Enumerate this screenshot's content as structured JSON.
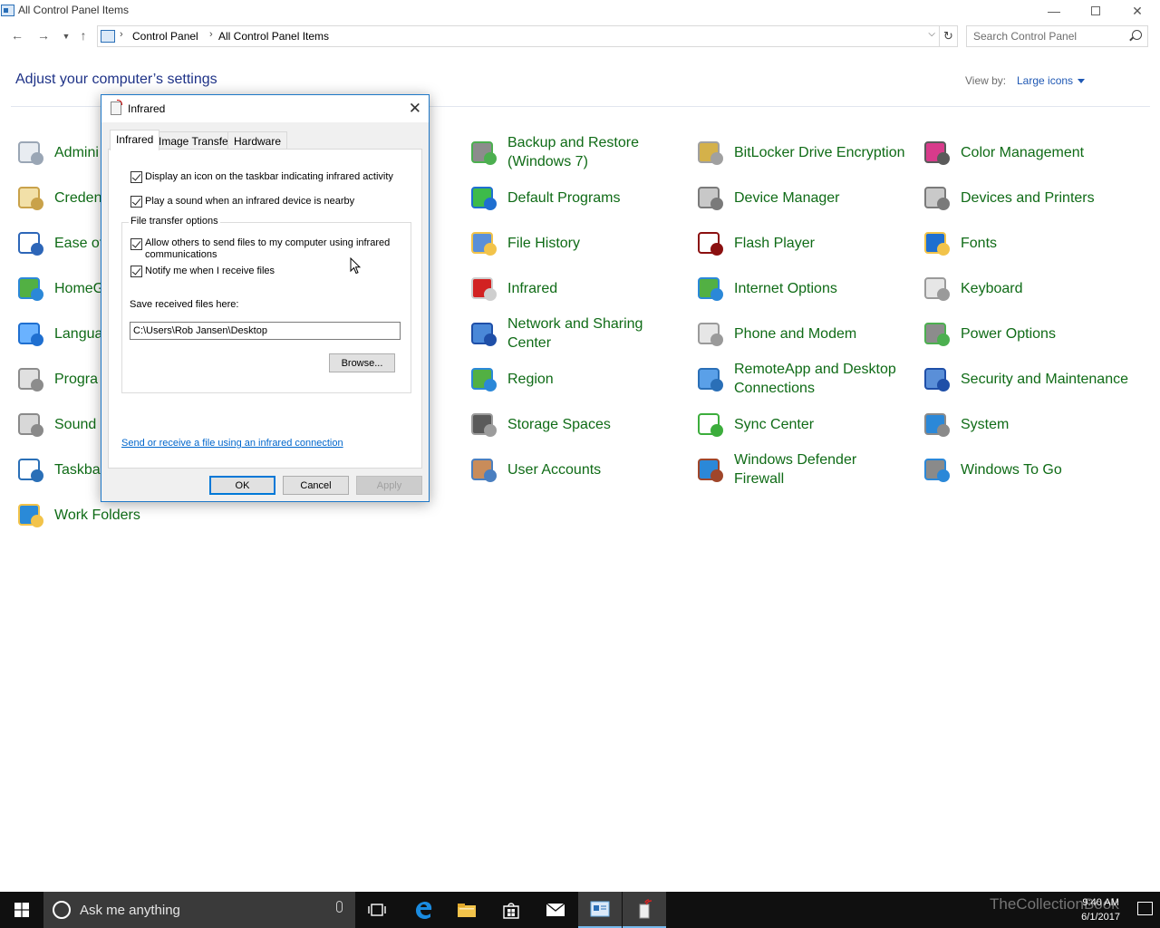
{
  "window": {
    "title": "All Control Panel Items"
  },
  "address": {
    "crumbs": [
      "Control Panel",
      "All Control Panel Items"
    ],
    "search_placeholder": "Search Control Panel"
  },
  "page": {
    "title": "Adjust your computer’s settings",
    "view_by_label": "View by:",
    "view_by_value": "Large icons"
  },
  "items": [
    {
      "label": "Admini",
      "icon": "administrative-tools-icon"
    },
    {
      "label": "Creden",
      "icon": "credential-manager-icon"
    },
    {
      "label": "Ease of",
      "icon": "ease-of-access-icon"
    },
    {
      "label": "HomeG",
      "icon": "homegroup-icon"
    },
    {
      "label": "Langua",
      "icon": "language-icon"
    },
    {
      "label": "Progra",
      "icon": "programs-icon"
    },
    {
      "label": "Sound",
      "icon": "sound-icon"
    },
    {
      "label": "Taskbar",
      "icon": "taskbar-icon"
    },
    {
      "label": "Work Folders",
      "icon": "work-folders-icon"
    },
    {
      "label": "Backup and Restore (Windows 7)",
      "icon": "backup-restore-icon"
    },
    {
      "label": "Default Programs",
      "icon": "default-programs-icon"
    },
    {
      "label": "File History",
      "icon": "file-history-icon"
    },
    {
      "label": "Infrared",
      "icon": "infrared-icon"
    },
    {
      "label": "Network and Sharing Center",
      "icon": "network-sharing-icon"
    },
    {
      "label": "Region",
      "icon": "region-icon"
    },
    {
      "label": "Storage Spaces",
      "icon": "storage-spaces-icon"
    },
    {
      "label": "User Accounts",
      "icon": "user-accounts-icon"
    },
    {
      "label": "BitLocker Drive Encryption",
      "icon": "bitlocker-icon"
    },
    {
      "label": "Device Manager",
      "icon": "device-manager-icon"
    },
    {
      "label": "Flash Player",
      "icon": "flash-player-icon"
    },
    {
      "label": "Internet Options",
      "icon": "internet-options-icon"
    },
    {
      "label": "Phone and Modem",
      "icon": "phone-modem-icon"
    },
    {
      "label": "RemoteApp and Desktop Connections",
      "icon": "remoteapp-icon"
    },
    {
      "label": "Sync Center",
      "icon": "sync-center-icon"
    },
    {
      "label": "Windows Defender Firewall",
      "icon": "firewall-icon"
    },
    {
      "label": "Color Management",
      "icon": "color-management-icon"
    },
    {
      "label": "Devices and Printers",
      "icon": "devices-printers-icon"
    },
    {
      "label": "Fonts",
      "icon": "fonts-icon"
    },
    {
      "label": "Keyboard",
      "icon": "keyboard-icon"
    },
    {
      "label": "Power Options",
      "icon": "power-options-icon"
    },
    {
      "label": "Security and Maintenance",
      "icon": "security-maintenance-icon"
    },
    {
      "label": "System",
      "icon": "system-icon"
    },
    {
      "label": "Windows To Go",
      "icon": "windows-to-go-icon"
    }
  ],
  "dialog": {
    "title": "Infrared",
    "tabs": [
      "Infrared",
      "Image Transfer",
      "Hardware"
    ],
    "active_tab": "Infrared",
    "options": [
      {
        "label": "Display an icon on the taskbar indicating infrared activity",
        "checked": true
      },
      {
        "label": "Play a sound when an infrared device is nearby",
        "checked": true
      }
    ],
    "group_title": "File transfer options",
    "group_options": [
      {
        "label": "Allow others to send files to my computer using infrared communications",
        "checked": true
      },
      {
        "label": "Notify me when I receive files",
        "checked": true
      }
    ],
    "save_label": "Save received files here:",
    "save_path": "C:\\Users\\Rob Jansen\\Desktop",
    "browse_label": "Browse...",
    "link_label": "Send or receive a file using an infrared connection",
    "ok_label": "OK",
    "cancel_label": "Cancel",
    "apply_label": "Apply"
  },
  "taskbar": {
    "search_placeholder": "Ask me anything",
    "time": "9:40 AM",
    "date": "6/1/2017",
    "watermark": "TheCollectionBook"
  },
  "colors": {
    "item_label": "#0f6b16",
    "page_title": "#1e3287",
    "link": "#0066cc",
    "dialog_border": "#1e78c8",
    "taskbar": "#101010"
  }
}
